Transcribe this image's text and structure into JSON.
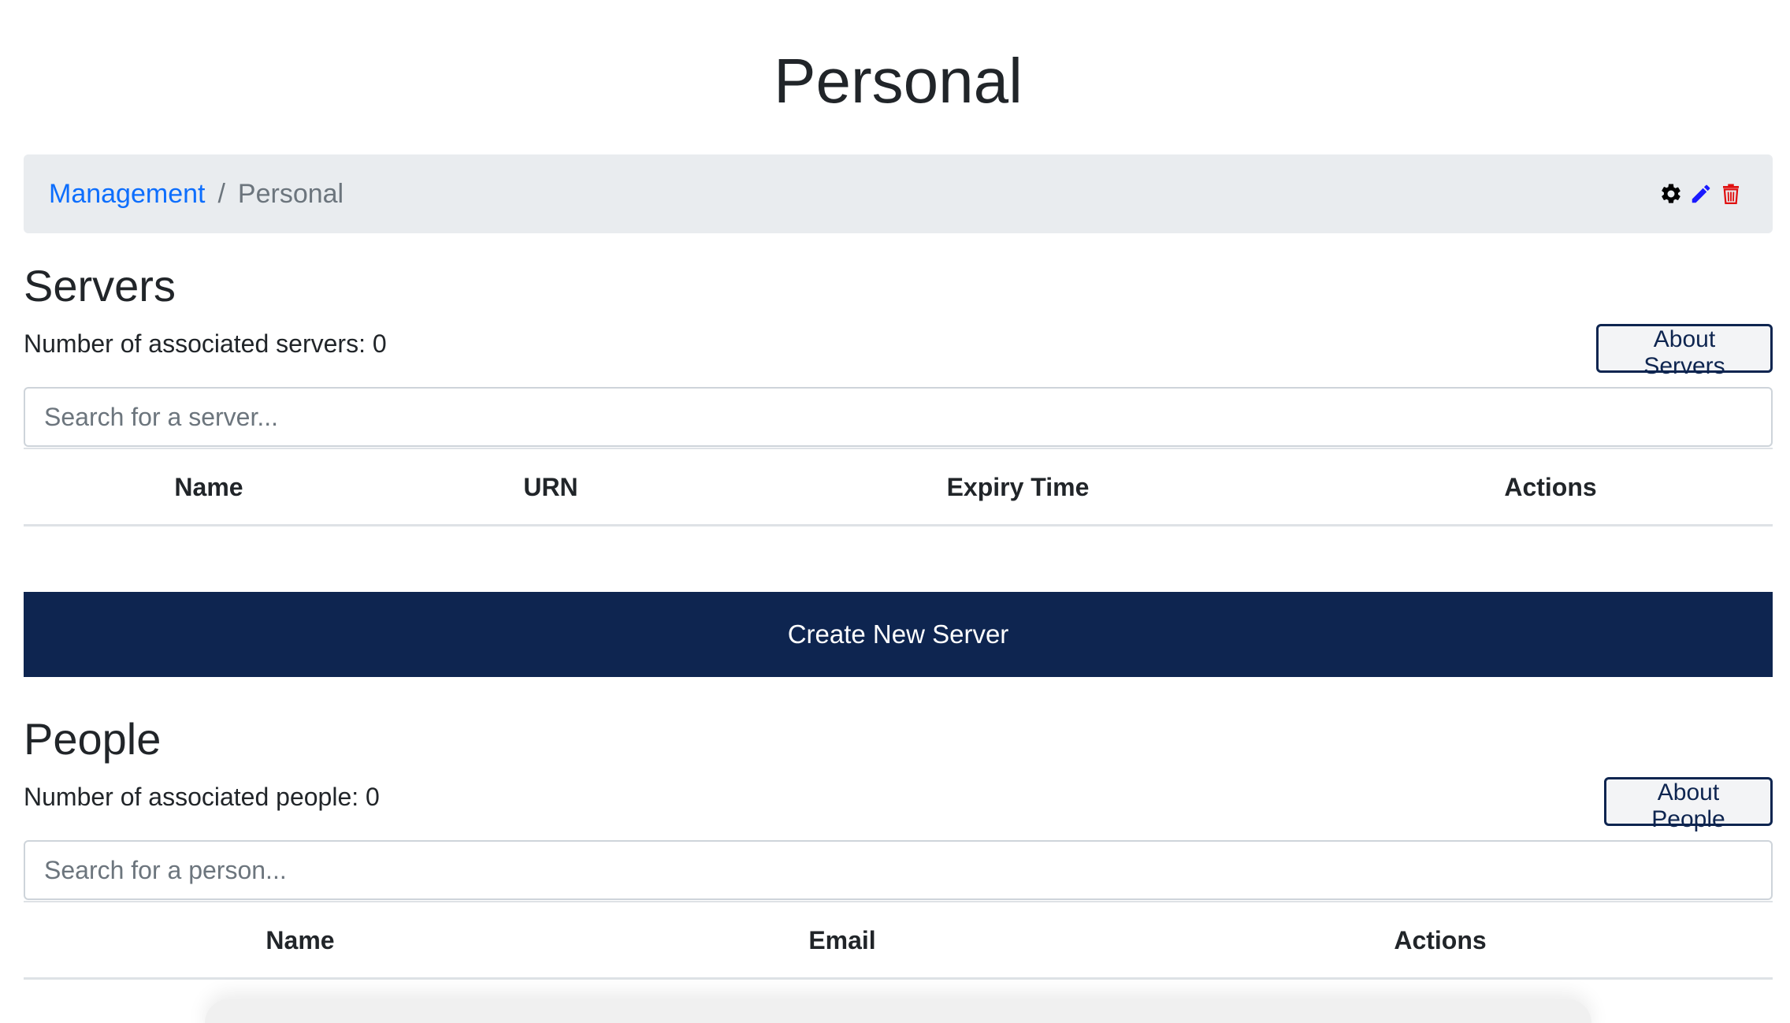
{
  "page": {
    "title": "Personal"
  },
  "breadcrumb": {
    "parent": "Management",
    "separator": "/",
    "current": "Personal"
  },
  "toolbar": {
    "settings_icon": "gear-icon",
    "edit_icon": "pencil-icon",
    "delete_icon": "trash-icon",
    "edit_color": "#1a1aff",
    "delete_color": "#e01010"
  },
  "servers": {
    "heading": "Servers",
    "count_text": "Number of associated servers: 0",
    "about_label": "About Servers",
    "search_placeholder": "Search for a server...",
    "columns": [
      "Name",
      "URN",
      "Expiry Time",
      "Actions"
    ],
    "rows": [],
    "create_label": "Create New Server"
  },
  "people": {
    "heading": "People",
    "count_text": "Number of associated people: 0",
    "about_label": "About People",
    "search_placeholder": "Search for a person...",
    "columns": [
      "Name",
      "Email",
      "Actions"
    ],
    "rows": []
  },
  "colors": {
    "primary_dark": "#0e2550",
    "link": "#0d6efd",
    "breadcrumb_bg": "#e9ecef"
  }
}
